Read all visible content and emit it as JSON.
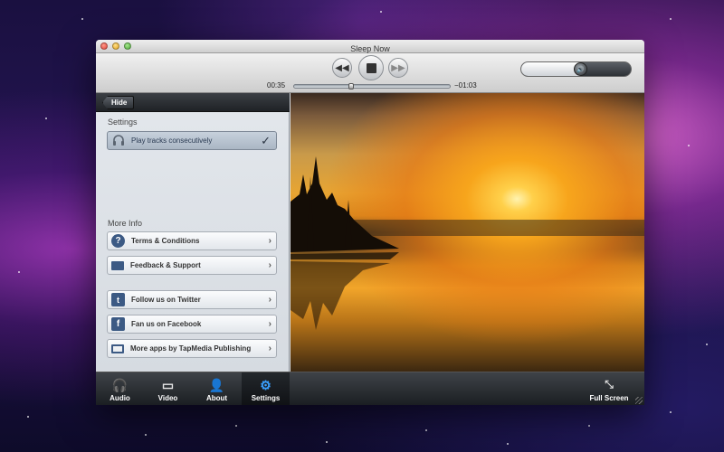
{
  "window": {
    "title": "Sleep Now"
  },
  "player": {
    "elapsed": "00:35",
    "remaining": "−01:03",
    "progress": 0.36,
    "volume": 0.55,
    "rewind_icon": "rewind-icon",
    "stop_icon": "stop-icon",
    "fastforward_icon": "fast-forward-icon",
    "volume_icon": "speaker-icon"
  },
  "sidebar": {
    "hide_label": "Hide",
    "settings_heading": "Settings",
    "settings_items": [
      {
        "label": "Play tracks consecutively",
        "icon": "headphones-icon",
        "checked": true
      }
    ],
    "more_info_heading": "More Info",
    "info_items": [
      {
        "label": "Terms & Conditions",
        "icon": "question-icon"
      },
      {
        "label": "Feedback & Support",
        "icon": "envelope-icon"
      }
    ],
    "social_items": [
      {
        "label": "Follow us on Twitter",
        "icon": "twitter-icon"
      },
      {
        "label": "Fan us on Facebook",
        "icon": "facebook-icon"
      },
      {
        "label": "More apps by TapMedia Publishing",
        "icon": "monitor-icon"
      }
    ]
  },
  "tabs": [
    {
      "label": "Audio",
      "icon": "headphones-icon",
      "active": false
    },
    {
      "label": "Video",
      "icon": "monitor-icon",
      "active": false
    },
    {
      "label": "About",
      "icon": "person-icon",
      "active": false
    },
    {
      "label": "Settings",
      "icon": "gear-icon",
      "active": true
    }
  ],
  "fullscreen": {
    "label": "Full Screen",
    "icon": "fullscreen-arrows-icon"
  },
  "colors": {
    "accent": "#3aa0ff",
    "icon_blue": "#3c5a84"
  }
}
